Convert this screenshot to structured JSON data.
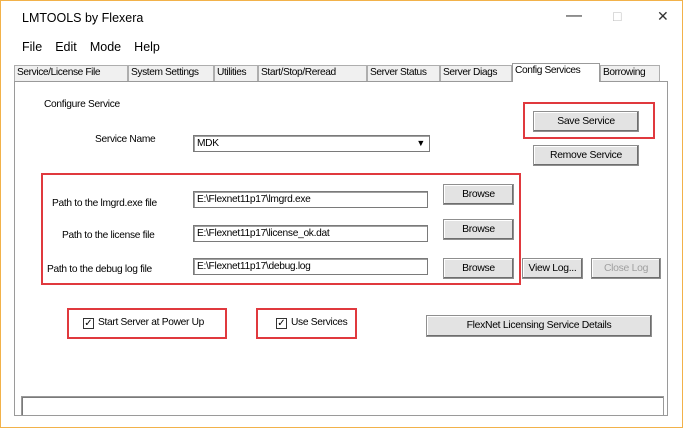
{
  "window": {
    "title": "LMTOOLS by Flexera",
    "minimize_glyph": "—",
    "maximize_glyph": "□",
    "close_glyph": "✕"
  },
  "menu": [
    "File",
    "Edit",
    "Mode",
    "Help"
  ],
  "tabs": [
    {
      "label": "Service/License File"
    },
    {
      "label": "System Settings"
    },
    {
      "label": "Utilities"
    },
    {
      "label": "Start/Stop/Reread"
    },
    {
      "label": "Server Status"
    },
    {
      "label": "Server Diags"
    },
    {
      "label": "Config Services",
      "active": true
    },
    {
      "label": "Borrowing"
    }
  ],
  "config": {
    "section_label": "Configure Service",
    "service_name_label": "Service Name",
    "service_name_value": "MDK",
    "save_button": "Save Service",
    "remove_button": "Remove Service",
    "lmgrd_label": "Path to the lmgrd.exe file",
    "lmgrd_value": "E:\\Flexnet11p17\\lmgrd.exe",
    "license_label": "Path to the license file",
    "license_value": "E:\\Flexnet11p17\\license_ok.dat",
    "debug_label": "Path to the debug log file",
    "debug_value": "E:\\Flexnet11p17\\debug.log",
    "browse_label": "Browse",
    "view_log_button": "View Log...",
    "close_log_button": "Close Log",
    "start_server_label": "Start Server at Power Up",
    "start_server_checked": true,
    "use_services_label": "Use Services",
    "use_services_checked": true,
    "details_button": "FlexNet Licensing Service Details"
  },
  "colors": {
    "highlight_box": "#e0393e",
    "window_border": "#f2b24a"
  }
}
